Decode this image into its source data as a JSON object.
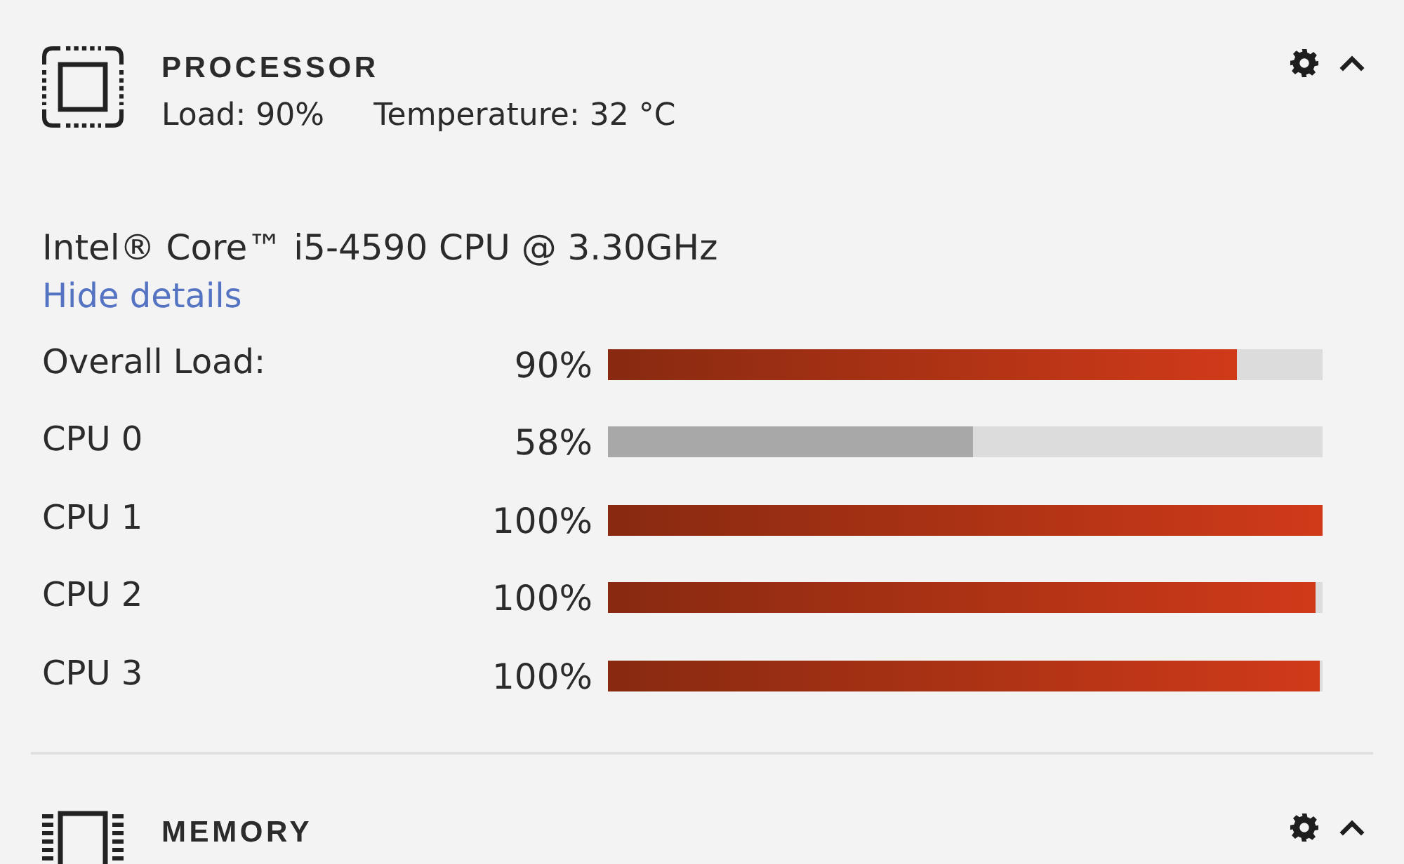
{
  "sections": [
    {
      "kind": "processor",
      "title": "PROCESSOR",
      "expanded": true,
      "summary": [
        "Load: 90%",
        "Temperature: 32 °C"
      ],
      "model": "Intel® Core™ i5-4590 CPU @ 3.30GHz",
      "details_link": "Hide details",
      "meters": [
        {
          "label": "Overall Load:",
          "reading": "90%",
          "level": 0.88,
          "alert": true
        },
        {
          "label": "CPU 0",
          "reading": "58%",
          "level": 0.51,
          "alert": false
        },
        {
          "label": "CPU 1",
          "reading": "100%",
          "level": 1.0,
          "alert": true
        },
        {
          "label": "CPU 2",
          "reading": "100%",
          "level": 0.99,
          "alert": true
        },
        {
          "label": "CPU 3",
          "reading": "100%",
          "level": 0.997,
          "alert": true
        }
      ]
    },
    {
      "kind": "memory",
      "title": "MEMORY",
      "expanded": true
    }
  ]
}
